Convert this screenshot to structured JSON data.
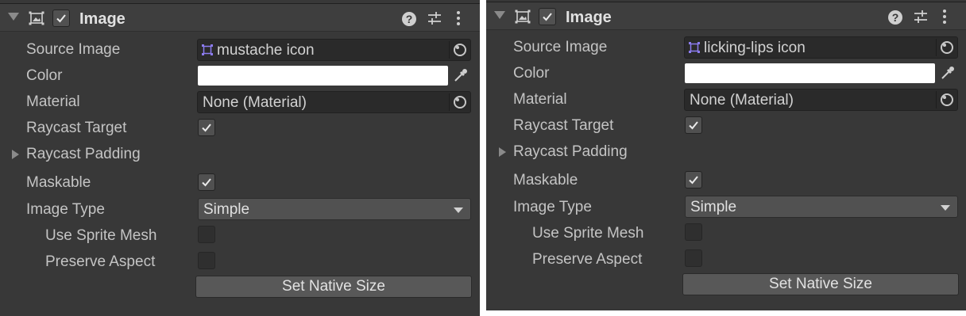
{
  "panels": [
    {
      "header": {
        "title": "Image",
        "enabled": true,
        "icons": [
          "image-component-icon",
          "help-icon",
          "preset-icon",
          "context-menu-icon"
        ]
      },
      "source_image": {
        "label": "Source Image",
        "value": "mustache icon"
      },
      "color": {
        "label": "Color",
        "value": "#ffffff"
      },
      "material": {
        "label": "Material",
        "value": "None (Material)"
      },
      "raycast_target": {
        "label": "Raycast Target",
        "checked": true
      },
      "raycast_padding": {
        "label": "Raycast Padding",
        "expanded": false
      },
      "maskable": {
        "label": "Maskable",
        "checked": true
      },
      "image_type": {
        "label": "Image Type",
        "value": "Simple"
      },
      "use_sprite_mesh": {
        "label": "Use Sprite Mesh",
        "checked": false
      },
      "preserve_aspect": {
        "label": "Preserve Aspect",
        "checked": false
      },
      "set_native_size": {
        "label": "Set Native Size"
      }
    },
    {
      "header": {
        "title": "Image",
        "enabled": true,
        "icons": [
          "image-component-icon",
          "help-icon",
          "preset-icon",
          "context-menu-icon"
        ]
      },
      "source_image": {
        "label": "Source Image",
        "value": "licking-lips icon"
      },
      "color": {
        "label": "Color",
        "value": "#ffffff"
      },
      "material": {
        "label": "Material",
        "value": "None (Material)"
      },
      "raycast_target": {
        "label": "Raycast Target",
        "checked": true
      },
      "raycast_padding": {
        "label": "Raycast Padding",
        "expanded": false
      },
      "maskable": {
        "label": "Maskable",
        "checked": true
      },
      "image_type": {
        "label": "Image Type",
        "value": "Simple"
      },
      "use_sprite_mesh": {
        "label": "Use Sprite Mesh",
        "checked": false
      },
      "preserve_aspect": {
        "label": "Preserve Aspect",
        "checked": false
      },
      "set_native_size": {
        "label": "Set Native Size"
      }
    }
  ],
  "colors": {
    "panel_bg": "#383838",
    "field_bg": "#2a2a2a",
    "sprite_accent": "#8c7cf0"
  }
}
